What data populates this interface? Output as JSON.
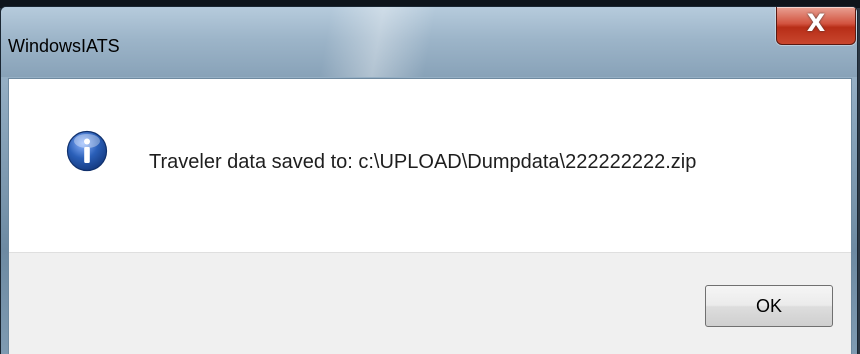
{
  "window": {
    "title": "WindowsIATS",
    "close_glyph": "X"
  },
  "dialog": {
    "icon": "information-icon",
    "message": "Traveler data saved to: c:\\UPLOAD\\Dumpdata\\222222222.zip",
    "ok_label": "OK"
  },
  "colors": {
    "titlebar": "#9db5c9",
    "close_button": "#c9472e",
    "content_bg": "#ffffff",
    "button_area_bg": "#f0f0f0",
    "info_icon": "#2a5fb8"
  }
}
